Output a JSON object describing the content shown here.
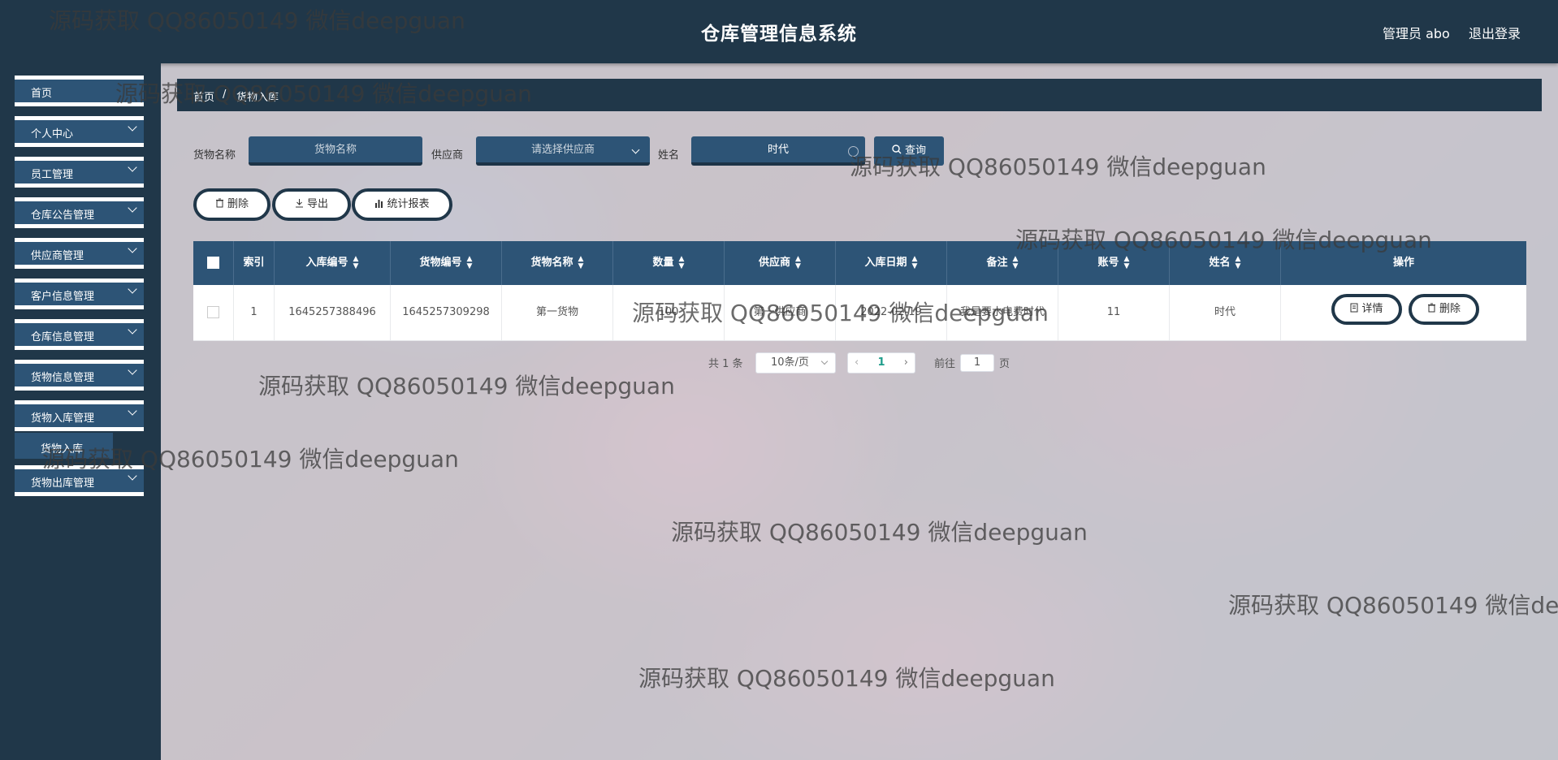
{
  "header": {
    "title": "仓库管理信息系统",
    "admin": "管理员 abo",
    "logout": "退出登录"
  },
  "sidebar": {
    "items": [
      {
        "label": "首页",
        "chevron": false
      },
      {
        "label": "个人中心",
        "chevron": true
      },
      {
        "label": "员工管理",
        "chevron": true
      },
      {
        "label": "仓库公告管理",
        "chevron": true
      },
      {
        "label": "供应商管理",
        "chevron": true
      },
      {
        "label": "客户信息管理",
        "chevron": true
      },
      {
        "label": "仓库信息管理",
        "chevron": true
      },
      {
        "label": "货物信息管理",
        "chevron": true
      },
      {
        "label": "货物入库管理",
        "chevron": true
      },
      {
        "label": "货物出库管理",
        "chevron": true
      }
    ],
    "sub_item": "货物入库"
  },
  "breadcrumb": {
    "home": "首页",
    "sep": "/",
    "current": "货物入库"
  },
  "search": {
    "goods_label": "货物名称",
    "goods_placeholder": "货物名称",
    "supplier_label": "供应商",
    "supplier_placeholder": "请选择供应商",
    "name_label": "姓名",
    "name_value": "时代",
    "search_button": "查询"
  },
  "actions": {
    "delete": "删除",
    "export": "导出",
    "report": "统计报表"
  },
  "table": {
    "headers": [
      "索引",
      "入库编号",
      "货物编号",
      "货物名称",
      "数量",
      "供应商",
      "入库日期",
      "备注",
      "账号",
      "姓名",
      "操作"
    ],
    "rows": [
      {
        "index": "1",
        "in_no": "1645257388496",
        "goods_no": "1645257309298",
        "goods_name": "第一货物",
        "qty": "100",
        "supplier": "第一供应商",
        "date": "2022-02-19",
        "remark": "我是要水电费时代",
        "account": "11",
        "name": "时代",
        "detail_btn": "详情",
        "delete_btn": "删除"
      }
    ]
  },
  "pagination": {
    "total": "共 1 条",
    "page_size": "10条/页",
    "current_page": "1",
    "goto": "前往",
    "goto_value": "1",
    "page_suffix": "页"
  },
  "watermark": "源码获取 QQ86050149 微信deepguan"
}
